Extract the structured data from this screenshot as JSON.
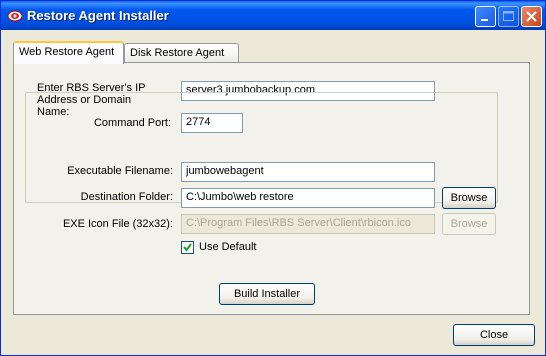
{
  "window": {
    "title": "Restore Agent Installer"
  },
  "tabs": [
    {
      "label": "Web Restore Agent",
      "active": true
    },
    {
      "label": "Disk Restore Agent",
      "active": false
    }
  ],
  "server": {
    "ip_label": "Enter RBS Server's IP Address or Domain Name:",
    "ip_label_lines": [
      "Enter RBS Server's IP",
      "Address or Domain",
      "Name:"
    ],
    "ip_value": "server3.jumbobackup.com",
    "port_label": "Command Port:",
    "port_value": "2774"
  },
  "installer": {
    "exe_label": "Executable Filename:",
    "exe_value": "jumbowebagent",
    "dest_label": "Destination Folder:",
    "dest_value": "C:\\Jumbo\\web restore",
    "dest_browse": "Browse",
    "icon_label": "EXE Icon File (32x32):",
    "icon_value": "C:\\Program Files\\RBS Server\\Client\\rbicon.ico",
    "icon_browse": "Browse",
    "use_default_label": "Use Default",
    "use_default_checked": true
  },
  "buttons": {
    "build": "Build Installer",
    "close": "Close"
  },
  "colors": {
    "titlebar": "#0054E3",
    "window_bg": "#ECE9D8",
    "tab_highlight": "#FFC83C"
  }
}
